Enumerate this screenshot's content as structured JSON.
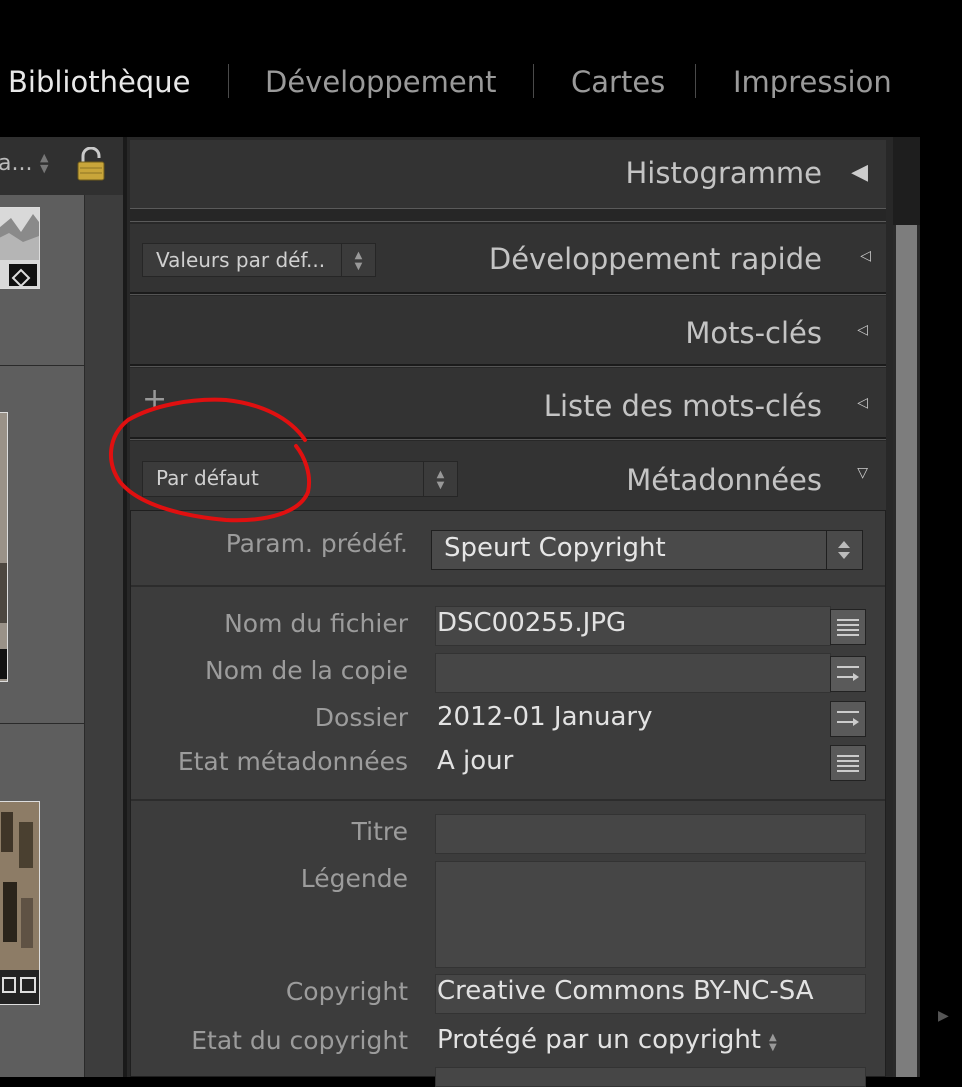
{
  "modules": [
    {
      "label": "Bibliothèque",
      "active": true
    },
    {
      "label": "Développement",
      "active": false
    },
    {
      "label": "Cartes",
      "active": false
    },
    {
      "label": "Impression",
      "active": false
    }
  ],
  "left_panel": {
    "truncated_label": "a...",
    "lock_icon": "padlock-icon"
  },
  "panels": {
    "histogram": {
      "title": "Histogramme",
      "icon": "collapse-left-triangle-icon"
    },
    "quick_develop": {
      "title": "Développement rapide",
      "preset": "Valeurs par déf...",
      "icon": "collapsed-triangle-icon"
    },
    "keywording": {
      "title": "Mots-clés",
      "icon": "collapsed-triangle-icon"
    },
    "keyword_list": {
      "title": "Liste des mots-clés",
      "add_symbol": "+",
      "icon": "collapsed-triangle-icon"
    },
    "metadata": {
      "title": "Métadonnées",
      "view_preset": "Par défaut",
      "icon": "expanded-triangle-icon"
    }
  },
  "metadata": {
    "preset_label": "Param. prédéf.",
    "preset_value": "Speurt Copyright",
    "file_name_label": "Nom du fichier",
    "file_name_value": "DSC00255.JPG",
    "copy_name_label": "Nom de la copie",
    "copy_name_value": "",
    "folder_label": "Dossier",
    "folder_value": "2012-01 January",
    "metadata_status_label": "Etat métadonnées",
    "metadata_status_value": "A jour",
    "title_label": "Titre",
    "title_value": "",
    "caption_label": "Légende",
    "caption_value": "",
    "copyright_label": "Copyright",
    "copyright_value": "Creative Commons BY-NC-SA",
    "copyright_status_label": "Etat du copyright",
    "copyright_status_value": "Protégé par un copyright"
  },
  "colors": {
    "annotation": "#e01010",
    "panel_bg": "#3c3c3c",
    "header_bg": "#333333",
    "scroll_thumb": "#7d7d7d"
  }
}
